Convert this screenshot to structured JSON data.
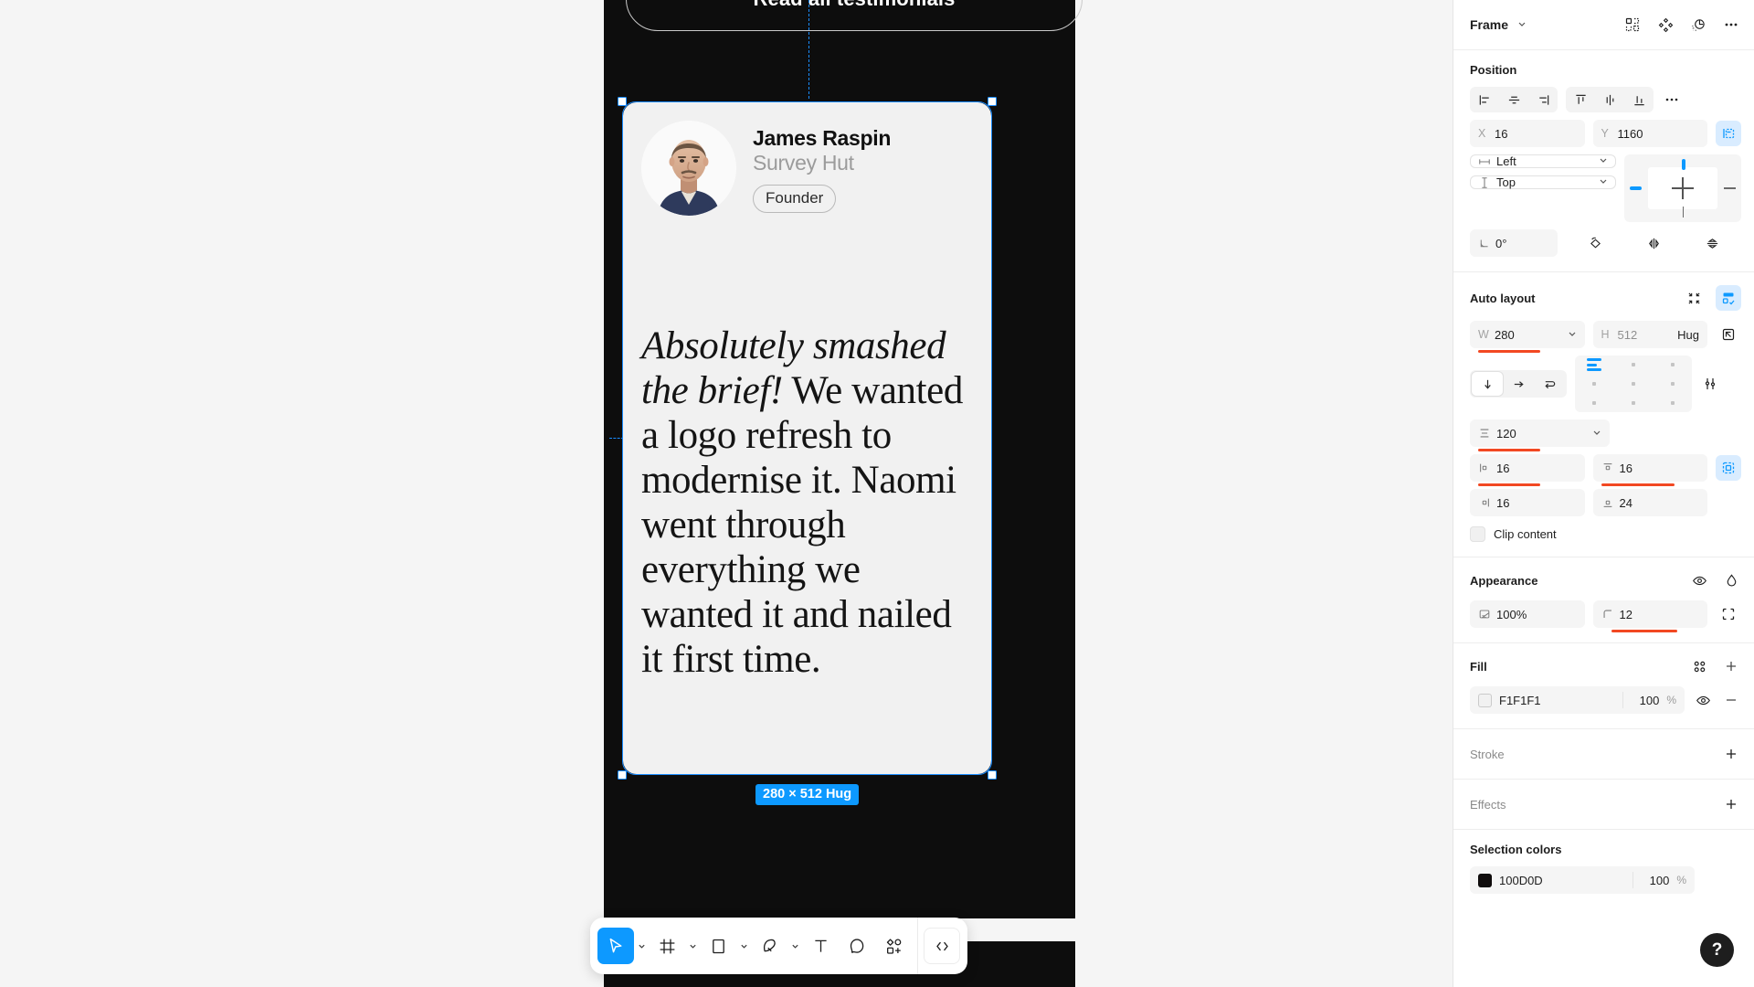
{
  "canvas": {
    "top_button_label": "Read all testimonials",
    "selection_size_badge": "280 × 512 Hug",
    "card": {
      "customer_name": "James Raspin",
      "company": "Survey Hut",
      "role_pill": "Founder",
      "quote_lead": "Absolutely smashed the brief!",
      "quote_rest": " We wanted a logo refresh to modernise it. Naomi went through everything we wanted it and nailed it first time."
    }
  },
  "toolbar": {
    "tools": [
      {
        "name": "move-tool",
        "icon": "cursor-icon",
        "active": true,
        "has_caret": true
      },
      {
        "name": "frame-tool",
        "icon": "frame-icon",
        "active": false,
        "has_caret": true
      },
      {
        "name": "shape-tool",
        "icon": "square-icon",
        "active": false,
        "has_caret": true
      },
      {
        "name": "pen-tool",
        "icon": "pen-icon",
        "active": false,
        "has_caret": true
      },
      {
        "name": "text-tool",
        "icon": "text-icon",
        "active": false,
        "has_caret": false
      },
      {
        "name": "comment-tool",
        "icon": "comment-icon",
        "active": false,
        "has_caret": false
      },
      {
        "name": "actions-tool",
        "icon": "plugins-icon",
        "active": false,
        "has_caret": false
      }
    ],
    "dev_mode_label": "</>"
  },
  "panel": {
    "header": {
      "title": "Frame",
      "icons": [
        "create-component-icon",
        "component-set-icon",
        "reset-instance-icon",
        "more-options-icon"
      ]
    },
    "position": {
      "title": "Position",
      "align_h": [
        "align-left-icon",
        "align-horizontal-center-icon",
        "align-right-icon"
      ],
      "align_v": [
        "align-top-icon",
        "align-vertical-center-icon",
        "align-bottom-icon"
      ],
      "more": "more-align-options",
      "x_label": "X",
      "x_value": "16",
      "y_label": "Y",
      "y_value": "1160",
      "horizontal_constraint": "Left",
      "vertical_constraint": "Top",
      "rotation": "0°",
      "extra_icons": [
        "rotate-icon",
        "flip-horizontal-icon",
        "flip-vertical-icon"
      ]
    },
    "auto_layout": {
      "title": "Auto layout",
      "w_label": "W",
      "w_value": "280",
      "h_label": "H",
      "h_value": "512",
      "h_mode": "Hug",
      "gap_value": "120",
      "pad_left": "16",
      "pad_top": "16",
      "pad_right": "16",
      "pad_bottom": "24",
      "clip_content_label": "Clip content",
      "clip_content_checked": false,
      "direction": "vertical"
    },
    "appearance": {
      "title": "Appearance",
      "opacity": "100%",
      "corner_radius": "12"
    },
    "fill": {
      "title": "Fill",
      "color_hex": "F1F1F1",
      "opacity": "100",
      "opacity_symbol": "%",
      "swatch": "#F1F1F1"
    },
    "stroke": {
      "title": "Stroke"
    },
    "effects": {
      "title": "Effects"
    },
    "selection_colors": {
      "title": "Selection colors",
      "color_hex": "100D0D",
      "opacity": "100",
      "opacity_symbol": "%",
      "swatch": "#100D0D"
    },
    "help_label": "?"
  },
  "colors": {
    "accent_blue": "#0d99ff",
    "highlight_red": "#f24822",
    "frame_background": "#0d0d0d",
    "card_background": "#F1F1F1"
  }
}
